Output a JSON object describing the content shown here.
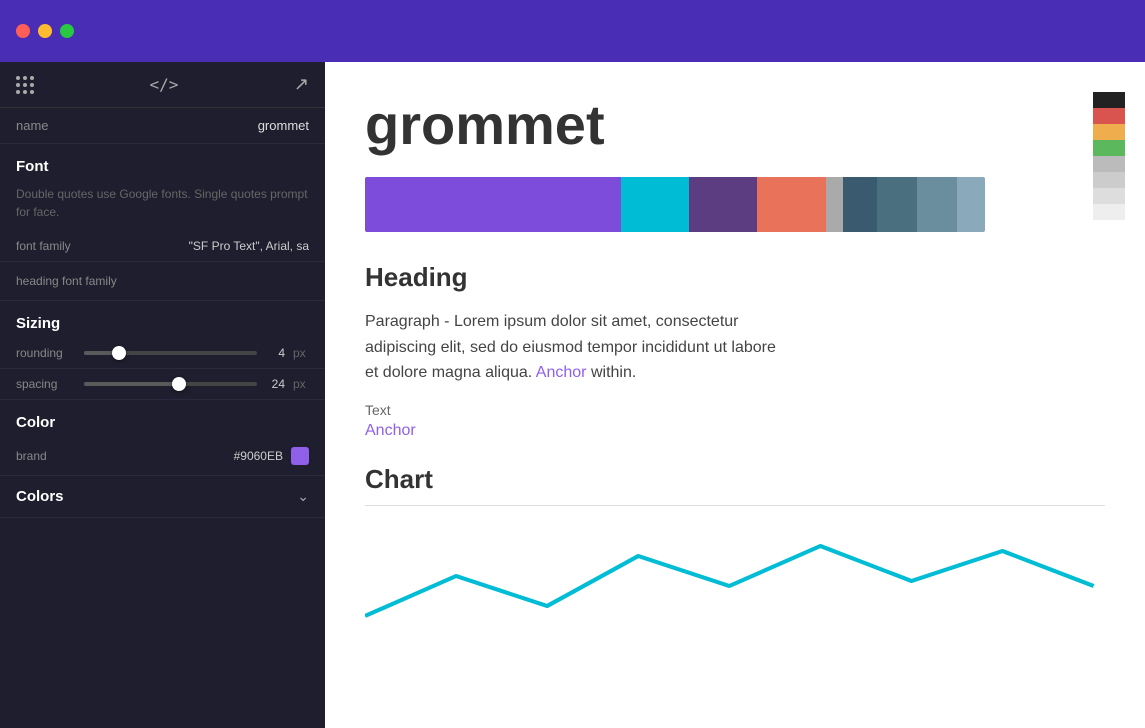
{
  "titlebar": {
    "traffic_lights": [
      "red",
      "yellow",
      "green"
    ]
  },
  "sidebar": {
    "toolbar_icons": [
      "grid",
      "code",
      "external-link"
    ],
    "name_label": "name",
    "name_value": "grommet",
    "font_section": "Font",
    "font_hint": "Double quotes use Google fonts. Single quotes prompt for face.",
    "font_family_label": "font family",
    "font_family_value": "\"SF Pro Text\", Arial, sa",
    "heading_font_label": "heading font family",
    "sizing_section": "Sizing",
    "rounding_label": "rounding",
    "rounding_value": "4",
    "rounding_unit": "px",
    "rounding_percent": 20,
    "spacing_label": "spacing",
    "spacing_value": "24",
    "spacing_unit": "px",
    "spacing_percent": 55,
    "color_section": "Color",
    "brand_label": "brand",
    "brand_hex": "#9060EB",
    "brand_color": "#9060EB",
    "colors_label": "Colors",
    "colors_collapsed": true
  },
  "content": {
    "app_title": "grommet",
    "palette_bars": [
      {
        "color": "#7D4CDB",
        "flex": 45
      },
      {
        "color": "#00BCD4",
        "flex": 12
      },
      {
        "color": "#5C3D82",
        "flex": 12
      },
      {
        "color": "#E8735A",
        "flex": 12
      },
      {
        "color": "#999",
        "flex": 4
      },
      {
        "color": "#3D5A80",
        "flex": 6
      },
      {
        "color": "#4A7098",
        "flex": 8
      },
      {
        "color": "#6B8CAE",
        "flex": 8
      },
      {
        "color": "#8EAAC8",
        "flex": 6
      }
    ],
    "heading_label": "Heading",
    "paragraph_text": "Paragraph - Lorem ipsum dolor sit amet, consectetur adipiscing elit, sed do eiusmod tempor incididunt ut labore et dolore magna aliqua.",
    "anchor_inline": "Anchor",
    "within_text": "within.",
    "text_label": "Text",
    "anchor_label": "Anchor",
    "chart_label": "Chart",
    "mini_palette": [
      {
        "color": "#222",
        "height": 18
      },
      {
        "color": "#d9534f",
        "height": 18
      },
      {
        "color": "#f0ad4e",
        "height": 18
      },
      {
        "color": "#5cb85c",
        "height": 18
      },
      {
        "color": "#bbb",
        "height": 18
      },
      {
        "color": "#ccc",
        "height": 18
      },
      {
        "color": "#ddd",
        "height": 18
      },
      {
        "color": "#eee",
        "height": 18
      }
    ]
  }
}
